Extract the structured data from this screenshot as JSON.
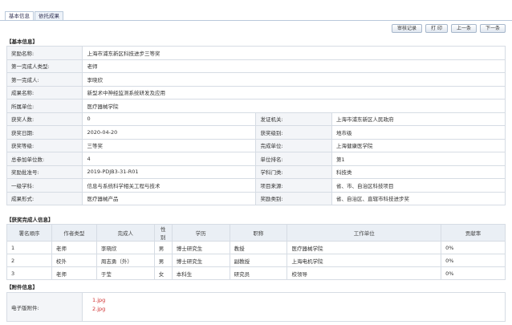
{
  "tabs": [
    "基本信息",
    "依托成果"
  ],
  "toolbar": {
    "history": "审核记录",
    "print": "打 印",
    "prev": "上一条",
    "next": "下一条"
  },
  "sections": {
    "basic": "【基本信息】",
    "people": "【获奖完成人信息】",
    "attach": "【附件信息】"
  },
  "basic": {
    "full_rows": [
      {
        "label": "奖励名称:",
        "value": "上海市浦东新区科技进步三等奖"
      },
      {
        "label": "第一完成人类型:",
        "value": "老师"
      },
      {
        "label": "第一完成人:",
        "value": "李晓欣"
      },
      {
        "label": "成果名称:",
        "value": "新型术中神经监测系统研发及应用"
      },
      {
        "label": "所属单位:",
        "value": "医疗器械学院"
      }
    ],
    "pair_rows": [
      {
        "l1": "获奖人数:",
        "v1": "0",
        "l2": "发证机关:",
        "v2": "上海市浦东新区人民政府"
      },
      {
        "l1": "获奖日期:",
        "v1": "2020-04-20",
        "l2": "获奖级别:",
        "v2": "地市级"
      },
      {
        "l1": "获奖等级:",
        "v1": "三等奖",
        "l2": "完成单位:",
        "v2": "上海健康医学院"
      },
      {
        "l1": "总参加单位数:",
        "v1": "4",
        "l2": "单位排名:",
        "v2": "第1"
      },
      {
        "l1": "奖励批准号:",
        "v1": "2019-PDJB3-31-R01",
        "l2": "学科门类:",
        "v2": "科技类"
      },
      {
        "l1": "一级学科:",
        "v1": "信息与系统科学相关工程与技术",
        "l2": "项目来源:",
        "v2": "省、市、自治区科技项目"
      },
      {
        "l1": "成果形式:",
        "v1": "医疗器械产品",
        "l2": "奖励类别:",
        "v2": "省、自治区、直辖市科技进步奖"
      }
    ]
  },
  "people": {
    "headers": [
      "署名顺序",
      "作者类型",
      "完成人",
      "性别",
      "学历",
      "职称",
      "工作单位",
      "贡献率"
    ],
    "rows": [
      [
        "1",
        "老师",
        "李晓欣",
        "男",
        "博士研究生",
        "教授",
        "医疗器械学院",
        "0%"
      ],
      [
        "2",
        "校外",
        "周志勇（外）",
        "男",
        "博士研究生",
        "副教授",
        "上海电机学院",
        "0%"
      ],
      [
        "3",
        "老师",
        "于莹",
        "女",
        "本科生",
        "研究员",
        "校领导",
        "0%"
      ]
    ]
  },
  "attach": {
    "label": "电子版附件:",
    "files": [
      "1.jpg",
      "2.jpg"
    ]
  }
}
